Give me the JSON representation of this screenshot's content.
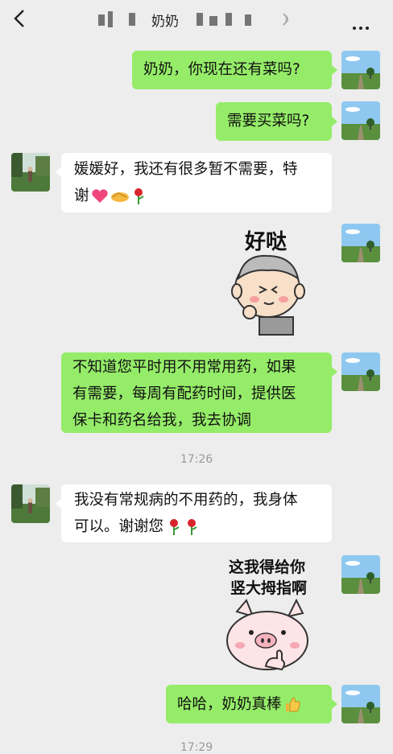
{
  "header": {
    "title": "奶奶",
    "voice_icon": "voice-icon",
    "more_icon": "more-icon",
    "back_icon": "back-icon"
  },
  "messages": [
    {
      "from": "me",
      "text": "奶奶，你现在还有菜吗?"
    },
    {
      "from": "me",
      "text": "需要买菜吗?"
    },
    {
      "from": "them",
      "line1": "媛媛好，我还有很多暂不需要，特",
      "line2": "谢"
    },
    {
      "from": "me",
      "sticker": "好哒"
    },
    {
      "from": "me",
      "line1": "不知道您平时用不用常用药，如果",
      "line2": "有需要，每周有配药时间，提供医",
      "line3": "保卡和药名给我，我去协调"
    },
    {
      "from": "them",
      "line1": "我没有常规病的不用药的，我身体",
      "line2": "可以。谢谢您"
    },
    {
      "from": "me",
      "sticker_line1": "这我得给你",
      "sticker_line2": "竖大拇指啊"
    },
    {
      "from": "me",
      "text": "哈哈，奶奶真棒"
    }
  ],
  "timestamps": {
    "t1": "17:26",
    "t2": "17:29"
  },
  "colors": {
    "my_bubble": "#95ec69",
    "their_bubble": "#ffffff",
    "background": "#ededed"
  }
}
